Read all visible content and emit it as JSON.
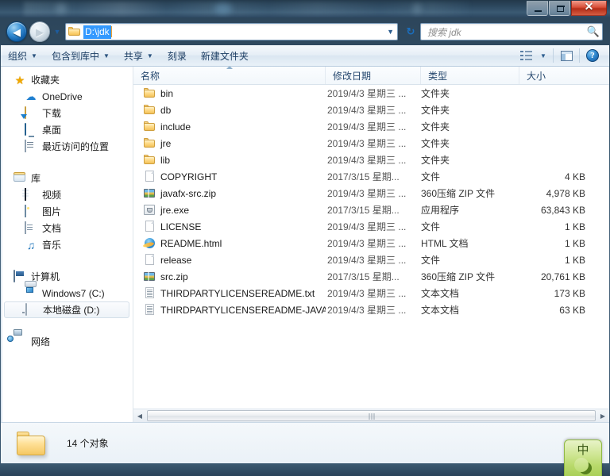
{
  "window": {
    "title": "",
    "controls": {
      "minimize": "minimize",
      "maximize": "maximize",
      "close": "✕"
    }
  },
  "navigation": {
    "back_label": "◀",
    "forward_label": "▶",
    "history_dropdown": "▼",
    "address": {
      "path": "D:\\jdk",
      "dropdown": "▼"
    },
    "refresh_label": "↻",
    "search": {
      "placeholder": "搜索 jdk",
      "icon": "search-icon"
    }
  },
  "toolbar": {
    "items": [
      {
        "label": "组织",
        "caret": "▼"
      },
      {
        "label": "包含到库中",
        "caret": "▼"
      },
      {
        "label": "共享",
        "caret": "▼"
      },
      {
        "label": "刻录",
        "caret": ""
      },
      {
        "label": "新建文件夹",
        "caret": ""
      }
    ],
    "view_caret": "▼",
    "help_label": "?"
  },
  "sidebar": {
    "groups": [
      {
        "header": {
          "label": "收藏夹",
          "icon": "star-icon"
        },
        "items": [
          {
            "label": "OneDrive",
            "icon": "cloud-icon"
          },
          {
            "label": "下载",
            "icon": "download-icon"
          },
          {
            "label": "桌面",
            "icon": "desktop-icon"
          },
          {
            "label": "最近访问的位置",
            "icon": "recent-places-icon"
          }
        ]
      },
      {
        "header": {
          "label": "库",
          "icon": "library-icon"
        },
        "items": [
          {
            "label": "视频",
            "icon": "video-icon"
          },
          {
            "label": "图片",
            "icon": "pictures-icon"
          },
          {
            "label": "文档",
            "icon": "documents-icon"
          },
          {
            "label": "音乐",
            "icon": "music-icon"
          }
        ]
      },
      {
        "header": {
          "label": "计算机",
          "icon": "computer-icon"
        },
        "items": [
          {
            "label": "Windows7 (C:)",
            "icon": "windows-drive-icon",
            "selected": false
          },
          {
            "label": "本地磁盘 (D:)",
            "icon": "drive-icon",
            "selected": true
          }
        ]
      },
      {
        "header": {
          "label": "网络",
          "icon": "network-icon"
        },
        "items": []
      }
    ]
  },
  "filelist": {
    "columns": [
      {
        "label": "名称",
        "sorted": true
      },
      {
        "label": "修改日期",
        "sorted": false
      },
      {
        "label": "类型",
        "sorted": false
      },
      {
        "label": "大小",
        "sorted": false
      }
    ],
    "rows": [
      {
        "name": "bin",
        "icon": "folder-icon",
        "date": "2019/4/3 星期三 ...",
        "type": "文件夹",
        "size": ""
      },
      {
        "name": "db",
        "icon": "folder-icon",
        "date": "2019/4/3 星期三 ...",
        "type": "文件夹",
        "size": ""
      },
      {
        "name": "include",
        "icon": "folder-icon",
        "date": "2019/4/3 星期三 ...",
        "type": "文件夹",
        "size": ""
      },
      {
        "name": "jre",
        "icon": "folder-icon",
        "date": "2019/4/3 星期三 ...",
        "type": "文件夹",
        "size": ""
      },
      {
        "name": "lib",
        "icon": "folder-icon",
        "date": "2019/4/3 星期三 ...",
        "type": "文件夹",
        "size": ""
      },
      {
        "name": "COPYRIGHT",
        "icon": "file-icon",
        "date": "2017/3/15 星期...",
        "type": "文件",
        "size": "4 KB"
      },
      {
        "name": "javafx-src.zip",
        "icon": "zip-icon",
        "date": "2019/4/3 星期三 ...",
        "type": "360压缩 ZIP 文件",
        "size": "4,978 KB"
      },
      {
        "name": "jre.exe",
        "icon": "java-exe-icon",
        "date": "2017/3/15 星期...",
        "type": "应用程序",
        "size": "63,843 KB"
      },
      {
        "name": "LICENSE",
        "icon": "file-icon",
        "date": "2019/4/3 星期三 ...",
        "type": "文件",
        "size": "1 KB"
      },
      {
        "name": "README.html",
        "icon": "ie-html-icon",
        "date": "2019/4/3 星期三 ...",
        "type": "HTML 文档",
        "size": "1 KB"
      },
      {
        "name": "release",
        "icon": "file-icon",
        "date": "2019/4/3 星期三 ...",
        "type": "文件",
        "size": "1 KB"
      },
      {
        "name": "src.zip",
        "icon": "zip-icon",
        "date": "2017/3/15 星期...",
        "type": "360压缩 ZIP 文件",
        "size": "20,761 KB"
      },
      {
        "name": "THIRDPARTYLICENSEREADME.txt",
        "icon": "text-icon",
        "date": "2019/4/3 星期三 ...",
        "type": "文本文档",
        "size": "173 KB"
      },
      {
        "name": "THIRDPARTYLICENSEREADME-JAVAF...",
        "icon": "text-icon",
        "date": "2019/4/3 星期三 ...",
        "type": "文本文档",
        "size": "63 KB"
      }
    ],
    "scrollbar": {
      "left_arrow": "◀",
      "right_arrow": "▶"
    }
  },
  "statusbar": {
    "text": "14 个对象"
  },
  "ime": {
    "mode": "中"
  }
}
